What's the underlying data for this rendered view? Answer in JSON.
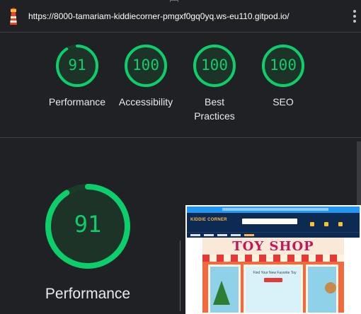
{
  "browser": {
    "url": "https://8000-tamariam-kiddiecorner-pmgxf0gq0yq.ws-eu110.gitpod.io/"
  },
  "colors": {
    "pass": "#0cce6b",
    "background": "#202124"
  },
  "summary": {
    "gauges": [
      {
        "score": 91,
        "score_text": "91",
        "label": "Performance"
      },
      {
        "score": 100,
        "score_text": "100",
        "label": "Accessibility"
      },
      {
        "score": 100,
        "score_text": "100",
        "label_line1": "Best",
        "label_line2": "Practices"
      },
      {
        "score": 100,
        "score_text": "100",
        "label": "SEO"
      }
    ]
  },
  "performance": {
    "score": 91,
    "score_text": "91",
    "title": "Performance"
  },
  "screenshot": {
    "logo_text": "KIDDIE CORNER",
    "sign_text": "TOY SHOP",
    "tagline": "Find Your New Favorite Toy"
  },
  "icons": {
    "lighthouse": "lighthouse-icon",
    "menu": "kebab-menu-icon"
  }
}
